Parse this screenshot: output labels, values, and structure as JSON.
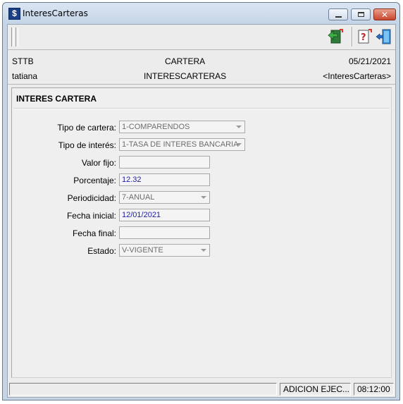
{
  "window": {
    "title": "InteresCarteras",
    "icon_glyph": "$"
  },
  "toolbar": {
    "icons": [
      "back-arrow-icon",
      "help-icon",
      "exit-door-icon"
    ]
  },
  "header": {
    "org": "STTB",
    "module": "CARTERA",
    "date": "05/21/2021",
    "user": "tatiana",
    "screen": "INTERESCARTERAS",
    "screen_tag": "<InteresCarteras>"
  },
  "form": {
    "title": "INTERES CARTERA",
    "fields": [
      {
        "label": "Tipo de cartera:",
        "value": "1-COMPARENDOS",
        "type": "select"
      },
      {
        "label": "Tipo de interés:",
        "value": "1-TASA DE INTERES BANCARIA",
        "type": "select"
      },
      {
        "label": "Valor fijo:",
        "value": "",
        "type": "text"
      },
      {
        "label": "Porcentaje:",
        "value": "12.32",
        "type": "text"
      },
      {
        "label": "Periodicidad:",
        "value": "7-ANUAL",
        "type": "select"
      },
      {
        "label": "Fecha inicial:",
        "value": "12/01/2021",
        "type": "text"
      },
      {
        "label": "Fecha final:",
        "value": "",
        "type": "text"
      },
      {
        "label": "Estado:",
        "value": "V-VIGENTE",
        "type": "select"
      }
    ]
  },
  "status": {
    "message": "",
    "mode": "ADICION EJEC...",
    "time": "08:12:00"
  },
  "colors": {
    "frame": "#c6d5e6",
    "client_bg": "#ececec",
    "value_text": "#1c1ca0",
    "disabled_text": "#6d6d6d"
  }
}
